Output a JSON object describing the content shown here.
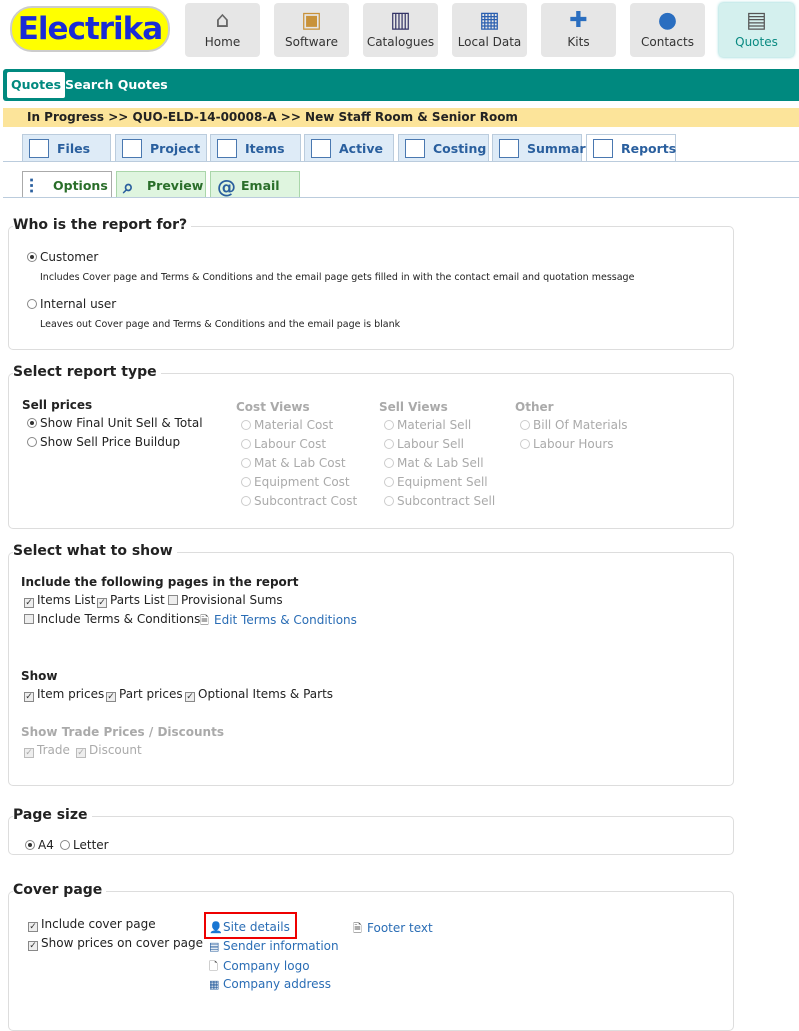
{
  "logo": "Electrika",
  "nav": [
    {
      "label": "Home",
      "icon": "home-icon"
    },
    {
      "label": "Software",
      "icon": "software-box-icon"
    },
    {
      "label": "Catalogues",
      "icon": "book-icon"
    },
    {
      "label": "Local Data",
      "icon": "database-building-icon"
    },
    {
      "label": "Kits",
      "icon": "puzzle-icon"
    },
    {
      "label": "Contacts",
      "icon": "contacts-icon"
    },
    {
      "label": "Quotes",
      "icon": "quote-icon",
      "active": true
    }
  ],
  "subnav": [
    "Quotes",
    "Search Quotes"
  ],
  "breadcrumb": "In Progress >> QUO-ELD-14-00008-A >> New Staff Room & Senior Room",
  "tabs": [
    "Files",
    "Project",
    "Items",
    "Active",
    "Costing",
    "Summary",
    "Reports"
  ],
  "subtabs": [
    "Options",
    "Preview",
    "Email"
  ],
  "who": {
    "title": "Who is the report for?",
    "customer": "Customer",
    "customer_desc": "Includes Cover page and Terms & Conditions and the email page gets filled in with the contact email and quotation message",
    "internal": "Internal user",
    "internal_desc": "Leaves out Cover page and Terms & Conditions and the email page is blank"
  },
  "type": {
    "title": "Select report type",
    "sell_prices": "Sell prices",
    "sell_opts": [
      "Show Final Unit Sell & Total",
      "Show Sell Price Buildup"
    ],
    "cost_views": "Cost Views",
    "cost_opts": [
      "Material Cost",
      "Labour Cost",
      "Mat & Lab Cost",
      "Equipment Cost",
      "Subcontract Cost"
    ],
    "sell_views": "Sell Views",
    "sellv_opts": [
      "Material Sell",
      "Labour Sell",
      "Mat & Lab Sell",
      "Equipment Sell",
      "Subcontract Sell"
    ],
    "other": "Other",
    "other_opts": [
      "Bill Of Materials",
      "Labour Hours"
    ]
  },
  "show": {
    "title": "Select what to show",
    "include_heading": "Include the following pages in the report",
    "items_list": "Items List",
    "parts_list": "Parts List",
    "prov_sums": "Provisional Sums",
    "terms": "Include Terms & Conditions",
    "edit_terms": "Edit Terms & Conditions",
    "show_heading": "Show",
    "item_prices": "Item prices",
    "part_prices": "Part prices",
    "optional": "Optional Items & Parts",
    "trade_heading": "Show Trade Prices / Discounts",
    "trade": "Trade",
    "discount": "Discount"
  },
  "page_size": {
    "title": "Page size",
    "a4": "A4",
    "letter": "Letter"
  },
  "cover": {
    "title": "Cover page",
    "include": "Include cover page",
    "show_prices": "Show prices on cover page",
    "links": [
      "Site details",
      "Sender information",
      "Company logo",
      "Company address"
    ],
    "footer": "Footer text"
  }
}
